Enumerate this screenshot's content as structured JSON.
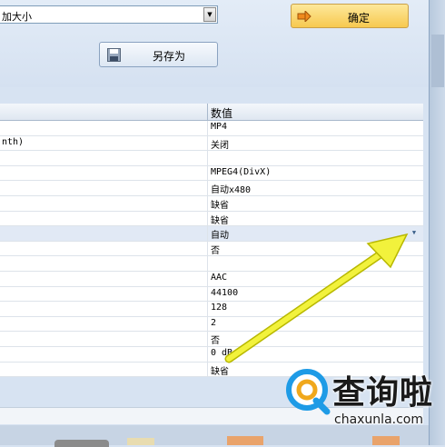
{
  "toolbar": {
    "size_combo_value": "加大小",
    "ok_label": "确定",
    "save_as_label": "另存为"
  },
  "grid": {
    "header": {
      "name": "",
      "value": "数值"
    },
    "rows": [
      {
        "name": "",
        "value": "MP4"
      },
      {
        "name": "nth)",
        "value": "关闭"
      },
      {
        "name": "",
        "value": ""
      },
      {
        "name": "",
        "value": "MPEG4(DivX)"
      },
      {
        "name": "",
        "value": "自动x480"
      },
      {
        "name": "",
        "value": "缺省"
      },
      {
        "name": "",
        "value": "缺省"
      },
      {
        "name": "",
        "value": "自动"
      },
      {
        "name": "",
        "value": "否"
      },
      {
        "name": "",
        "value": ""
      },
      {
        "name": "",
        "value": "AAC"
      },
      {
        "name": "",
        "value": "44100"
      },
      {
        "name": "",
        "value": "128"
      },
      {
        "name": "",
        "value": "2"
      },
      {
        "name": "",
        "value": "否"
      },
      {
        "name": "",
        "value": "0 dB"
      },
      {
        "name": "",
        "value": "缺省"
      }
    ]
  },
  "watermark": {
    "title": "查询啦",
    "url": "chaxunla.com"
  },
  "colors": {
    "arrow": "#f2f23c",
    "accent": "#f7c94f",
    "watermark_q": "#1e9be6"
  },
  "icons": [
    "combo-dropdown-icon",
    "arrow-right-icon",
    "floppy-disk-icon",
    "cell-dropdown-icon",
    "magnifier-q-icon"
  ]
}
